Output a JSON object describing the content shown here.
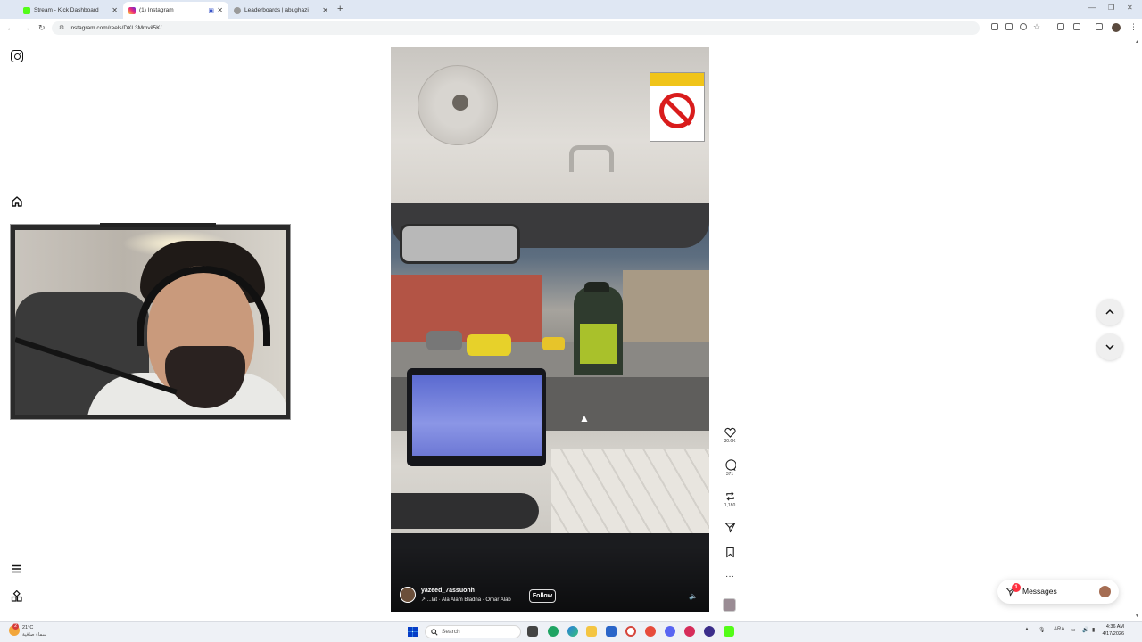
{
  "browser": {
    "tabs": [
      {
        "label": "Stream - Kick Dashboard",
        "color": "#53fc18",
        "active": false
      },
      {
        "label": "(1) Instagram",
        "color": "#e1306c",
        "active": true
      },
      {
        "label": "Leaderboards | abughazi",
        "color": "#888888",
        "active": false
      }
    ],
    "new_tab": "+",
    "url": "instagram.com/reels/DXL3Mmvil5K/"
  },
  "instagram": {
    "left_nav": [
      "instagram-logo-icon",
      "home-icon",
      "menu-icon",
      "apps-icon"
    ],
    "reel": {
      "author": "yazeed_7assuonh",
      "music": "↗ ...lat · Ala Alam Bladna · Omar Alab",
      "follow_label": "Follow"
    },
    "actions": {
      "likes": "30.6K",
      "comments": "371",
      "reposts": "1,180"
    },
    "messages": {
      "label": "Messages",
      "badge": "1"
    }
  },
  "taskbar": {
    "weather_temp": "21°C",
    "weather_desc": "سماء صافية",
    "weather_badge": "2",
    "search_placeholder": "Search",
    "language": "ARA",
    "time": "4:36 AM",
    "date": "4/17/2026"
  }
}
